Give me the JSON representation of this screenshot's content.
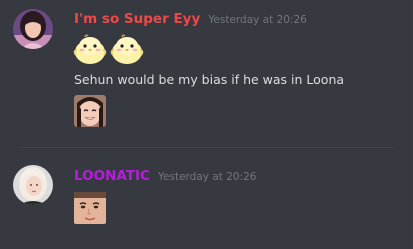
{
  "messages": [
    {
      "author": "I'm so Super Eyy",
      "author_color": "#f04747",
      "timestamp": "Yesterday at 20:26",
      "avatar_icon": "girl-profile-photo",
      "emojis": [
        "chick-emoji",
        "chick-emoji"
      ],
      "text": "Sehun would be my bias if he was in Loona",
      "attachment_icon": "smiling-face-sticker"
    },
    {
      "author": "LOONATIC",
      "author_color": "#b71ddc",
      "timestamp": "Yesterday at 20:26",
      "avatar_icon": "blonde-girl-profile-photo",
      "attachment_icon": "face-closeup-sticker"
    }
  ],
  "colors": {
    "background": "#36393f",
    "text": "#dcddde",
    "timestamp": "#72767d",
    "divider": "#40434a"
  }
}
